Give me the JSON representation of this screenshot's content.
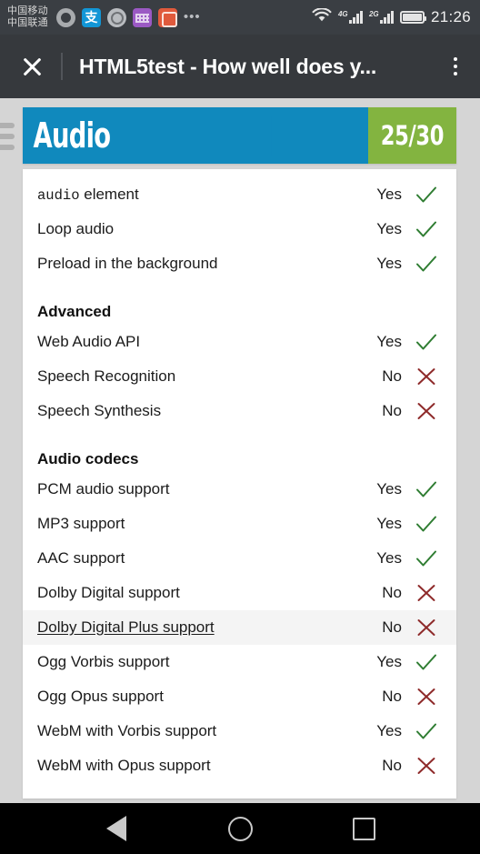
{
  "status_bar": {
    "carrier_line1": "中国移动",
    "carrier_line2": "中国联通",
    "notification_icons": [
      "qq-icon",
      "alipay-icon",
      "search-circle-icon",
      "keyboard-icon",
      "red-app-icon"
    ],
    "more_icon_label": "•••",
    "wifi_icon": "wifi-icon",
    "signal_4g_label": "4G",
    "signal_2g_label": "2G",
    "battery_icon": "battery-full-icon",
    "clock": "21:26"
  },
  "app_bar": {
    "close_icon": "close-icon",
    "title": "HTML5test - How well does y...",
    "overflow_icon": "overflow-menu-icon"
  },
  "side_menu": {
    "icon": "hamburger-menu-icon"
  },
  "score_header": {
    "category": "Audio",
    "score": "25/30",
    "blue": "#1089bd",
    "green": "#83b440"
  },
  "colors": {
    "yes_mark": "#2f7d32",
    "no_mark": "#8e2a2a",
    "page_bg": "#d5d5d5",
    "card_bg": "#ffffff",
    "highlight_row": "#f4f4f4"
  },
  "list": [
    {
      "type": "row",
      "code": "audio",
      "label": " element",
      "value": "Yes",
      "mark": "check-icon"
    },
    {
      "type": "row",
      "label": "Loop audio",
      "value": "Yes",
      "mark": "check-icon"
    },
    {
      "type": "row",
      "label": "Preload in the background",
      "value": "Yes",
      "mark": "check-icon"
    },
    {
      "type": "section",
      "label": "Advanced"
    },
    {
      "type": "row",
      "label": "Web Audio API",
      "value": "Yes",
      "mark": "check-icon"
    },
    {
      "type": "row",
      "label": "Speech Recognition",
      "value": "No",
      "mark": "cross-icon"
    },
    {
      "type": "row",
      "label": "Speech Synthesis",
      "value": "No",
      "mark": "cross-icon"
    },
    {
      "type": "section",
      "label": "Audio codecs"
    },
    {
      "type": "row",
      "label": "PCM audio support",
      "value": "Yes",
      "mark": "check-icon"
    },
    {
      "type": "row",
      "label": "MP3 support",
      "value": "Yes",
      "mark": "check-icon"
    },
    {
      "type": "row",
      "label": "AAC support",
      "value": "Yes",
      "mark": "check-icon"
    },
    {
      "type": "row",
      "label": "Dolby Digital support",
      "value": "No",
      "mark": "cross-icon"
    },
    {
      "type": "row",
      "label": "Dolby Digital Plus support",
      "value": "No",
      "mark": "cross-icon",
      "highlight": true
    },
    {
      "type": "row",
      "label": "Ogg Vorbis support",
      "value": "Yes",
      "mark": "check-icon"
    },
    {
      "type": "row",
      "label": "Ogg Opus support",
      "value": "No",
      "mark": "cross-icon"
    },
    {
      "type": "row",
      "label": "WebM with Vorbis support",
      "value": "Yes",
      "mark": "check-icon"
    },
    {
      "type": "row",
      "label": "WebM with Opus support",
      "value": "No",
      "mark": "cross-icon"
    }
  ],
  "nav_bar": {
    "back_icon": "back-triangle-icon",
    "home_icon": "home-circle-icon",
    "recents_icon": "recents-square-icon"
  }
}
